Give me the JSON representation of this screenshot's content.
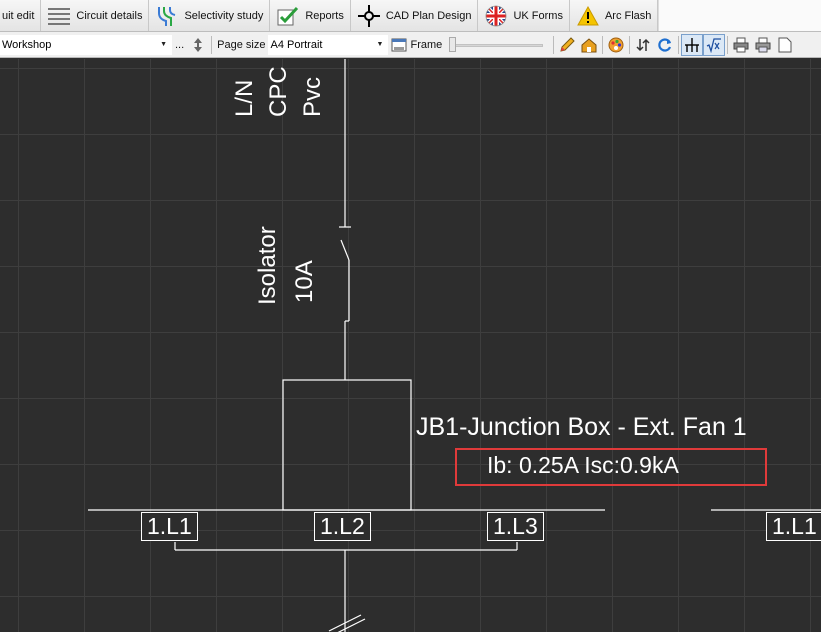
{
  "tabs": [
    {
      "label": "uit edit",
      "icon": "none"
    },
    {
      "label": "Circuit details",
      "icon": "circuit-details-icon"
    },
    {
      "label": "Selectivity study",
      "icon": "selectivity-icon"
    },
    {
      "label": "Reports",
      "icon": "reports-check-icon"
    },
    {
      "label": "CAD Plan Design",
      "icon": "crosshair-icon"
    },
    {
      "label": "UK Forms",
      "icon": "uk-flag-icon"
    },
    {
      "label": "Arc Flash",
      "icon": "warning-icon"
    }
  ],
  "toolbar": {
    "location_value": "Workshop",
    "more_label": "...",
    "page_size_label": "Page size",
    "page_size_value": "A4 Portrait",
    "frame_label": "Frame"
  },
  "drawing": {
    "cable_text": [
      "L/N",
      "CPC",
      "Pvc"
    ],
    "isolator_name": "Isolator",
    "isolator_rating": "10A",
    "box_title": "JB1-Junction Box - Ext. Fan 1",
    "box_values": "Ib: 0.25A Isc:0.9kA",
    "bus_labels": [
      "1.L1",
      "1.L2",
      "1.L3",
      "1.L1"
    ]
  },
  "colors": {
    "canvas_bg": "#2d2d2d",
    "grid": "#3e3e3e",
    "lines": "#ffffff",
    "highlight": "#e03a3a"
  }
}
